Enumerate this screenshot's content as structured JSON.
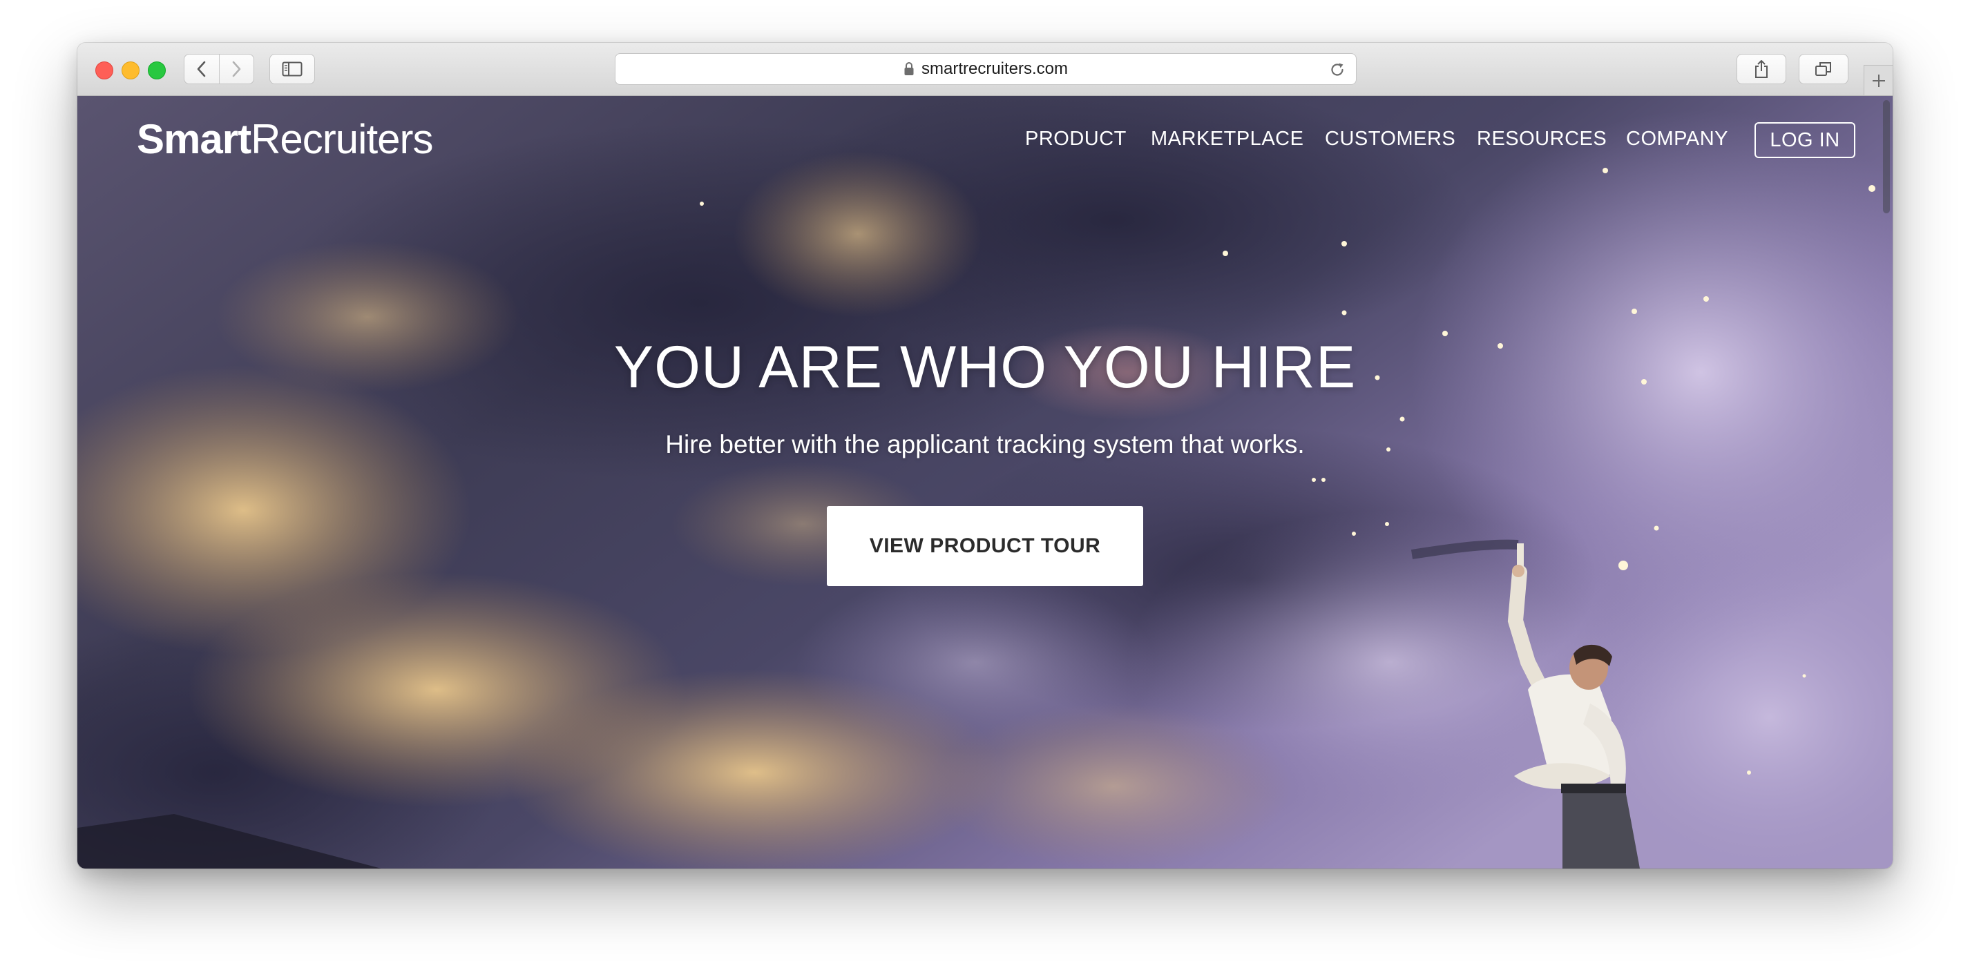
{
  "browser": {
    "url": "smartrecruiters.com",
    "icons": {
      "back": "chevron-left-icon",
      "forward": "chevron-right-icon",
      "sidebar": "sidebar-icon",
      "lock": "lock-icon",
      "reload": "reload-icon",
      "share": "share-icon",
      "tabs": "tabs-overview-icon",
      "new_tab": "plus-icon"
    }
  },
  "site": {
    "logo_bold": "Smart",
    "logo_light": "Recruiters",
    "nav": [
      {
        "label": "PRODUCT"
      },
      {
        "label": "MARKETPLACE"
      },
      {
        "label": "CUSTOMERS"
      },
      {
        "label": "RESOURCES"
      },
      {
        "label": "COMPANY"
      }
    ],
    "login_label": "LOG IN"
  },
  "hero": {
    "title": "YOU ARE WHO YOU HIRE",
    "subtitle": "Hire better with the applicant tracking system that works.",
    "cta_label": "VIEW PRODUCT TOUR"
  },
  "colors": {
    "traffic_close": "#fe5f57",
    "traffic_minimize": "#febc2e",
    "traffic_maximize": "#28c840",
    "sky_dark": "#3b3a55",
    "sky_purple": "#8d7fb0",
    "cloud_gold": "#d9b57a",
    "text_white": "#ffffff"
  }
}
